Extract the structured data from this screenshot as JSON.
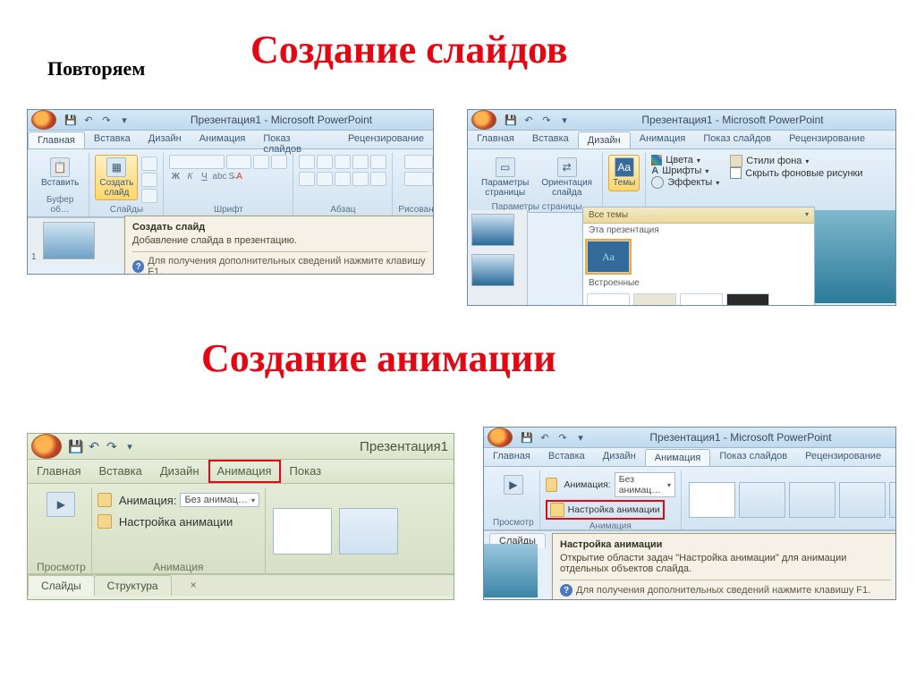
{
  "labels": {
    "repeat": "Повторяем",
    "title1": "Создание слайдов",
    "title2": "Создание анимации"
  },
  "common": {
    "app_title": "Презентация1 - Microsoft PowerPoint",
    "f1": "Для получения дополнительных сведений нажмите клавишу F1."
  },
  "tabs": {
    "home": "Главная",
    "insert": "Вставка",
    "design": "Дизайн",
    "anim": "Анимация",
    "show": "Показ слайдов",
    "review": "Рецензирование"
  },
  "win1": {
    "paste": "Вставить",
    "new_slide": "Создать\nслайд",
    "g_clipboard": "Буфер об…",
    "g_slides": "Слайды",
    "g_font": "Шрифт",
    "g_para": "Абзац",
    "g_draw": "Рисовани",
    "tt_title": "Создать слайд",
    "tt_body": "Добавление слайда в презентацию."
  },
  "win2": {
    "page_setup": "Параметры\nстраницы",
    "orient": "Ориентация\nслайда",
    "themes": "Темы",
    "g_page": "Параметры страницы",
    "colors": "Цвета",
    "fonts": "Шрифты",
    "effects": "Эффекты",
    "bg_styles": "Стили фона",
    "hide_bg": "Скрыть фоновые рисунки",
    "all_themes": "Все темы",
    "this_pres": "Эта презентация",
    "builtin": "Встроенные",
    "aa": "Aa"
  },
  "win3": {
    "title_short": "Презентация1",
    "preview": "Просмотр",
    "anim_settings": "Настройка анимации",
    "anim_label": "Анимация:",
    "anim_value": "Без анимац…",
    "g_anim": "Анимация",
    "slides_tab": "Слайды",
    "outline_tab": "Структура",
    "close_x": "×"
  },
  "win4": {
    "preview": "Просмотр",
    "anim_label": "Анимация:",
    "anim_value": "Без анимац…",
    "anim_settings": "Настройка анимации",
    "g_preview": "Просмотр",
    "g_anim": "Анимация",
    "slides_tab": "Слайды",
    "tt_title": "Настройка анимации",
    "tt_body": "Открытие области задач \"Настройка анимации\" для анимации отдельных объектов слайда."
  }
}
